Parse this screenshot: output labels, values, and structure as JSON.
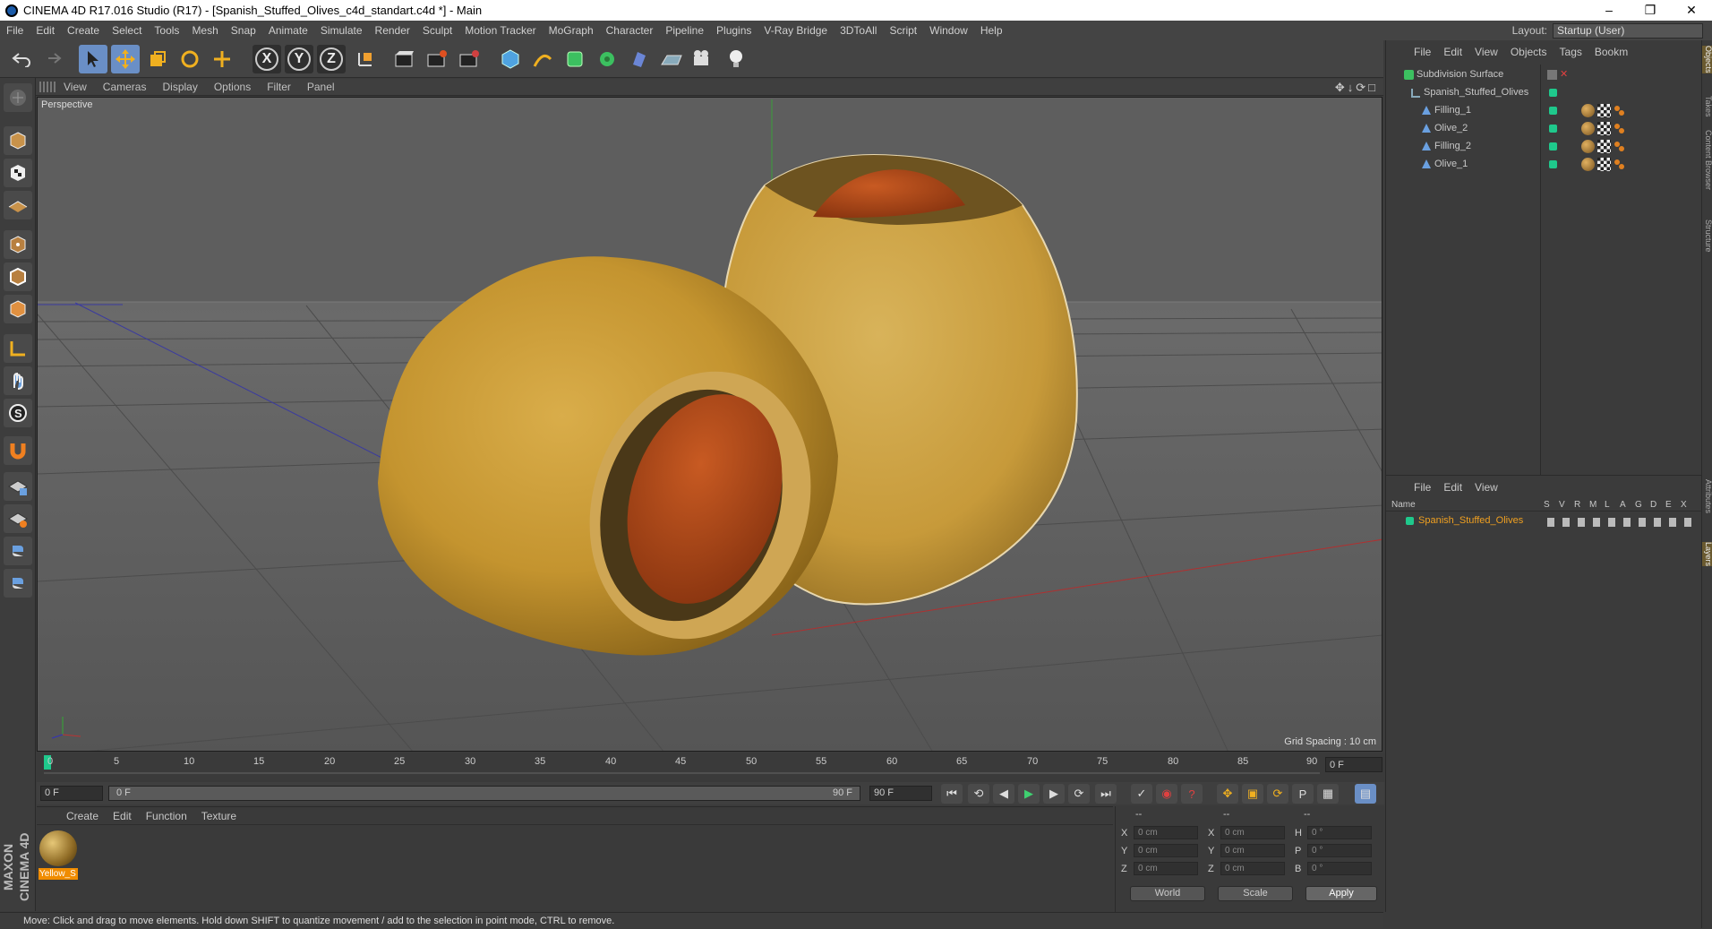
{
  "window": {
    "title": "CINEMA 4D R17.016 Studio (R17) - [Spanish_Stuffed_Olives_c4d_standart.c4d *] - Main"
  },
  "menubar": {
    "items": [
      "File",
      "Edit",
      "Create",
      "Select",
      "Tools",
      "Mesh",
      "Snap",
      "Animate",
      "Simulate",
      "Render",
      "Sculpt",
      "Motion Tracker",
      "MoGraph",
      "Character",
      "Pipeline",
      "Plugins",
      "V-Ray Bridge",
      "3DToAll",
      "Script",
      "Window",
      "Help"
    ],
    "layout_label": "Layout:",
    "layout_value": "Startup (User)"
  },
  "toolbar": {
    "axis_x": "X",
    "axis_y": "Y",
    "axis_z": "Z"
  },
  "viewport": {
    "menu": [
      "View",
      "Cameras",
      "Display",
      "Options",
      "Filter",
      "Panel"
    ],
    "label": "Perspective",
    "grid_spacing": "Grid Spacing : 10 cm"
  },
  "timeline": {
    "ticks": [
      "0",
      "5",
      "10",
      "15",
      "20",
      "25",
      "30",
      "35",
      "40",
      "45",
      "50",
      "55",
      "60",
      "65",
      "70",
      "75",
      "80",
      "85",
      "90"
    ],
    "current_frame": "0 F"
  },
  "playback": {
    "start_field": "0 F",
    "slider_start": "0 F",
    "slider_end": "90 F",
    "end_field": "90 F"
  },
  "material_panel": {
    "menu": [
      "Create",
      "Edit",
      "Function",
      "Texture"
    ],
    "materials": [
      {
        "name": "Yellow_S"
      }
    ]
  },
  "coords": {
    "header": [
      "--",
      "--",
      "--"
    ],
    "rows": [
      {
        "a": "X",
        "av": "0 cm",
        "b": "X",
        "bv": "0 cm",
        "c": "H",
        "cv": "0 °"
      },
      {
        "a": "Y",
        "av": "0 cm",
        "b": "Y",
        "bv": "0 cm",
        "c": "P",
        "cv": "0 °"
      },
      {
        "a": "Z",
        "av": "0 cm",
        "b": "Z",
        "bv": "0 cm",
        "c": "B",
        "cv": "0 °"
      }
    ],
    "world": "World",
    "scale": "Scale",
    "apply": "Apply"
  },
  "objects": {
    "menu": [
      "File",
      "Edit",
      "View",
      "Objects",
      "Tags",
      "Bookm"
    ],
    "items": [
      {
        "name": "Subdivision Surface"
      },
      {
        "name": "Spanish_Stuffed_Olives"
      },
      {
        "name": "Filling_1"
      },
      {
        "name": "Olive_2"
      },
      {
        "name": "Filling_2"
      },
      {
        "name": "Olive_1"
      }
    ]
  },
  "layers": {
    "menu": [
      "File",
      "Edit",
      "View"
    ],
    "name_header": "Name",
    "cols": [
      "S",
      "V",
      "R",
      "M",
      "L",
      "A",
      "G",
      "D",
      "E",
      "X"
    ],
    "items": [
      {
        "name": "Spanish_Stuffed_Olives"
      }
    ]
  },
  "side_tabs": [
    "Objects",
    "Takes",
    "Content Browser",
    "Structure",
    "Attributes",
    "Layers"
  ],
  "statusbar": {
    "text": "Move: Click and drag to move elements. Hold down SHIFT to quantize movement / add to the selection in point mode, CTRL to remove."
  },
  "brand": {
    "text": "MAXON CINEMA 4D"
  },
  "colors": {
    "accent": "#6a8fc6",
    "layer_green": "#1fc98c",
    "material_orange": "#f08c00",
    "olive": "#c99a3a",
    "pimento": "#b8481a"
  }
}
